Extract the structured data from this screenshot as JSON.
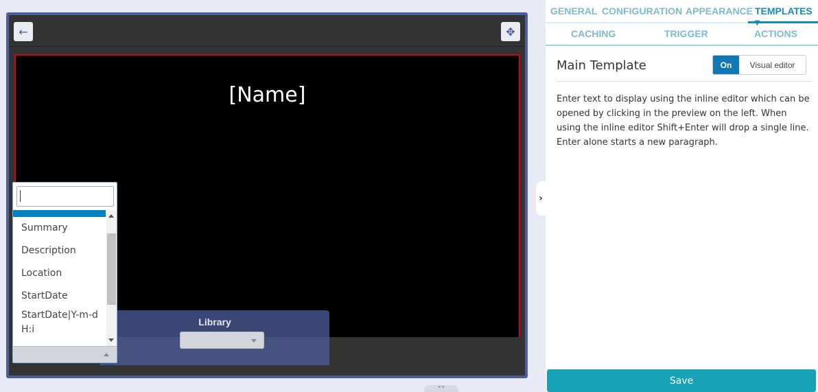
{
  "canvas": {
    "title": "[Name]",
    "accent_border": "#d0021b"
  },
  "toolbar": {
    "back_icon": "arrow-left-icon",
    "back_glyph": "←",
    "move_icon": "move-arrows-icon",
    "move_glyph": "✥"
  },
  "library": {
    "label": "Library",
    "selected": ""
  },
  "dropdown": {
    "search_value": "",
    "options": [
      "Summary",
      "Description",
      "Location",
      "StartDate",
      "StartDate|Y-m-d\nH:i"
    ],
    "highlight_color": "#0081c2"
  },
  "side_toggle": {
    "glyph": "›",
    "icon": "chevron-right-icon"
  },
  "bottom_handle": {
    "glyph": "ˇˇ"
  },
  "tabs": {
    "row1": [
      "GENERAL",
      "CONFIGURATION",
      "APPEARANCE",
      "TEMPLATES ▾"
    ],
    "row2": [
      "CACHING",
      "TRIGGER",
      "ACTIONS"
    ],
    "active": "TEMPLATES"
  },
  "section": {
    "title": "Main Template",
    "switch_on": "On",
    "switch_label": "Visual editor"
  },
  "help_text": "Enter text to display using the inline editor which can be opened by clicking in the preview on the left. When using the inline editor Shift+Enter will drop a single line. Enter alone starts a new paragraph.",
  "save_label": "Save",
  "colors": {
    "primary": "#1689b6",
    "save": "#17a2b8",
    "frame": "#4d5e9a"
  }
}
